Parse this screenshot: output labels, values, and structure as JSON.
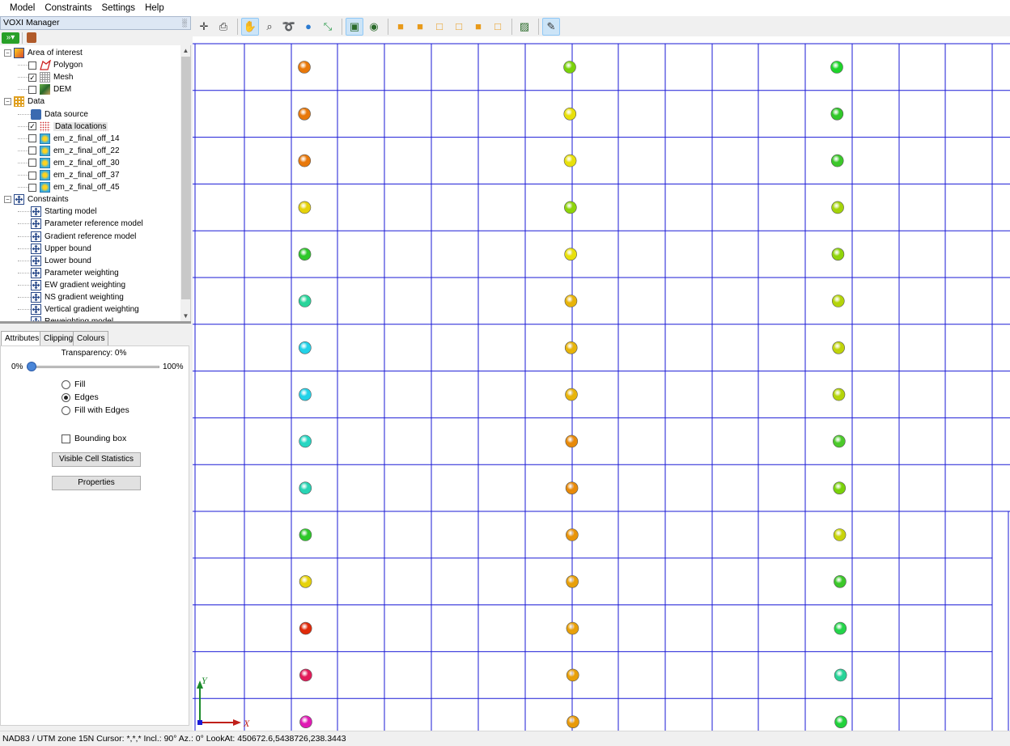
{
  "menu": {
    "items": [
      "Model",
      "Constraints",
      "Settings",
      "Help"
    ]
  },
  "panel": {
    "title": "VOXI Manager",
    "pin_glyph": "░"
  },
  "tree": {
    "nodes": [
      {
        "label": "Area of interest",
        "level": 0,
        "expander": "−",
        "checkbox": null,
        "icon": "area-of-interest-icon",
        "color": "#d84a2a"
      },
      {
        "label": "Polygon",
        "level": 1,
        "expander": null,
        "checkbox": false,
        "icon": "polygon-icon",
        "color": "#cc2222"
      },
      {
        "label": "Mesh",
        "level": 1,
        "expander": null,
        "checkbox": true,
        "icon": "mesh-icon",
        "color": "#8888aa"
      },
      {
        "label": "DEM",
        "level": 1,
        "expander": null,
        "checkbox": false,
        "icon": "dem-icon",
        "color": "#4a8a3a"
      },
      {
        "label": "Data",
        "level": 0,
        "expander": "−",
        "checkbox": null,
        "icon": "data-icon",
        "color": "#e0a020"
      },
      {
        "label": "Data source",
        "level": 1,
        "expander": null,
        "checkbox": null,
        "icon": "data-source-icon",
        "color": "#3a6ab0"
      },
      {
        "label": "Data locations",
        "level": 1,
        "expander": null,
        "checkbox": true,
        "icon": "data-locations-icon",
        "color": "#cc2222"
      },
      {
        "label": "em_z_final_off_14",
        "level": 1,
        "expander": null,
        "checkbox": false,
        "icon": "grid-icon",
        "color": "#3a9ad0"
      },
      {
        "label": "em_z_final_off_22",
        "level": 1,
        "expander": null,
        "checkbox": false,
        "icon": "grid-icon",
        "color": "#3a9ad0"
      },
      {
        "label": "em_z_final_off_30",
        "level": 1,
        "expander": null,
        "checkbox": false,
        "icon": "grid-icon",
        "color": "#3a9ad0"
      },
      {
        "label": "em_z_final_off_37",
        "level": 1,
        "expander": null,
        "checkbox": false,
        "icon": "grid-icon",
        "color": "#3a9ad0"
      },
      {
        "label": "em_z_final_off_45",
        "level": 1,
        "expander": null,
        "checkbox": false,
        "icon": "grid-icon",
        "color": "#3a9ad0"
      },
      {
        "label": "Constraints",
        "level": 0,
        "expander": "−",
        "checkbox": null,
        "icon": "constraint-icon",
        "color": "#2a4a8a"
      },
      {
        "label": "Starting model",
        "level": 1,
        "expander": null,
        "checkbox": null,
        "icon": "constraint-icon",
        "color": "#2a4a8a"
      },
      {
        "label": "Parameter reference model",
        "level": 1,
        "expander": null,
        "checkbox": null,
        "icon": "constraint-icon",
        "color": "#2a4a8a"
      },
      {
        "label": "Gradient reference model",
        "level": 1,
        "expander": null,
        "checkbox": null,
        "icon": "constraint-icon",
        "color": "#2a4a8a"
      },
      {
        "label": "Upper bound",
        "level": 1,
        "expander": null,
        "checkbox": null,
        "icon": "constraint-icon",
        "color": "#2a4a8a"
      },
      {
        "label": "Lower bound",
        "level": 1,
        "expander": null,
        "checkbox": null,
        "icon": "constraint-icon",
        "color": "#2a4a8a"
      },
      {
        "label": "Parameter weighting",
        "level": 1,
        "expander": null,
        "checkbox": null,
        "icon": "constraint-icon",
        "color": "#2a4a8a"
      },
      {
        "label": "EW gradient weighting",
        "level": 1,
        "expander": null,
        "checkbox": null,
        "icon": "constraint-icon",
        "color": "#2a4a8a"
      },
      {
        "label": "NS gradient weighting",
        "level": 1,
        "expander": null,
        "checkbox": null,
        "icon": "constraint-icon",
        "color": "#2a4a8a"
      },
      {
        "label": "Vertical gradient weighting",
        "level": 1,
        "expander": null,
        "checkbox": null,
        "icon": "constraint-icon",
        "color": "#2a4a8a"
      },
      {
        "label": "Reweighting model",
        "level": 1,
        "expander": null,
        "checkbox": null,
        "icon": "constraint-icon",
        "color": "#2a4a8a"
      }
    ]
  },
  "tabs": [
    {
      "label": "Attributes",
      "active": true
    },
    {
      "label": "Clipping",
      "active": false
    },
    {
      "label": "Colours",
      "active": false
    }
  ],
  "attributes": {
    "transparency_label": "Transparency: 0%",
    "transparency_value": 0,
    "slider_min_label": "0%",
    "slider_max_label": "100%",
    "render_options": [
      {
        "label": "Fill",
        "selected": false
      },
      {
        "label": "Edges",
        "selected": true
      },
      {
        "label": "Fill with Edges",
        "selected": false
      }
    ],
    "bounding_box_label": "Bounding box",
    "bounding_box_checked": false,
    "visible_cell_stats_button": "Visible Cell Statistics",
    "properties_button": "Properties"
  },
  "viewport_toolbar": {
    "tools": [
      {
        "name": "pan-select-icon",
        "glyph": "✛",
        "active": false
      },
      {
        "name": "print-icon",
        "glyph": "⎙",
        "active": false
      },
      {
        "name": "sep",
        "glyph": "",
        "active": false
      },
      {
        "name": "hand-pan-icon",
        "glyph": "✋",
        "active": true
      },
      {
        "name": "zoom-icon",
        "glyph": "⌕",
        "active": false
      },
      {
        "name": "lasso-icon",
        "glyph": "➰",
        "active": false
      },
      {
        "name": "globe-icon",
        "glyph": "●",
        "active": false
      },
      {
        "name": "fit-extent-icon",
        "glyph": "⤡",
        "active": false
      },
      {
        "name": "sep",
        "glyph": "",
        "active": false
      },
      {
        "name": "layer-view-icon",
        "glyph": "▣",
        "active": true
      },
      {
        "name": "surface-view-icon",
        "glyph": "◉",
        "active": false
      },
      {
        "name": "sep",
        "glyph": "",
        "active": false
      },
      {
        "name": "cube-front-icon",
        "glyph": "■",
        "active": false
      },
      {
        "name": "cube-back-icon",
        "glyph": "■",
        "active": false
      },
      {
        "name": "cube-left-icon",
        "glyph": "□",
        "active": false
      },
      {
        "name": "cube-right-icon",
        "glyph": "□",
        "active": false
      },
      {
        "name": "cube-top-icon",
        "glyph": "■",
        "active": false
      },
      {
        "name": "cube-bottom-icon",
        "glyph": "□",
        "active": false
      },
      {
        "name": "sep",
        "glyph": "",
        "active": false
      },
      {
        "name": "view-reset-icon",
        "glyph": "▨",
        "active": false
      },
      {
        "name": "sep",
        "glyph": "",
        "active": false
      },
      {
        "name": "draw-box-icon",
        "glyph": "✎",
        "active": true
      }
    ]
  },
  "viewport": {
    "grid_color": "#1a1ad6",
    "axis_x_label": "X",
    "axis_y_label": "Y",
    "axis_x_color": "#c0201a",
    "axis_y_color": "#1a8a2a",
    "columns": [
      {
        "colors": [
          "#e8780a",
          "#e8780a",
          "#e8780a",
          "#e6d20a",
          "#2ec82a",
          "#28d49a",
          "#22d2e8",
          "#22d2e8",
          "#26d6c2",
          "#28d4b4",
          "#2ec82a",
          "#e6d20a",
          "#e02a0a",
          "#e21c5a",
          "#e01ab4"
        ]
      },
      {
        "colors": [
          "#7ad20a",
          "#e8e00a",
          "#e8e00a",
          "#8ed40a",
          "#e8e00a",
          "#e8b40a",
          "#e8b40a",
          "#e8b40a",
          "#e88a0a",
          "#e88a0a",
          "#e8940a",
          "#e8a00a",
          "#e8a00a",
          "#e8a00a",
          "#e89a0a"
        ]
      },
      {
        "colors": [
          "#1ed42a",
          "#32c82a",
          "#3cc82a",
          "#a4d40a",
          "#90d40a",
          "#b4d40a",
          "#c0d40a",
          "#b4d40a",
          "#4cca2a",
          "#7ad20a",
          "#c8d40a",
          "#3cc82a",
          "#24d44a",
          "#28d498",
          "#22d23c"
        ]
      }
    ]
  },
  "status": {
    "text": "NAD83 / UTM zone 15N  Cursor: *,*,*  Incl.: 90° Az.: 0° LookAt: 450672.6,5438726,238.3443"
  }
}
